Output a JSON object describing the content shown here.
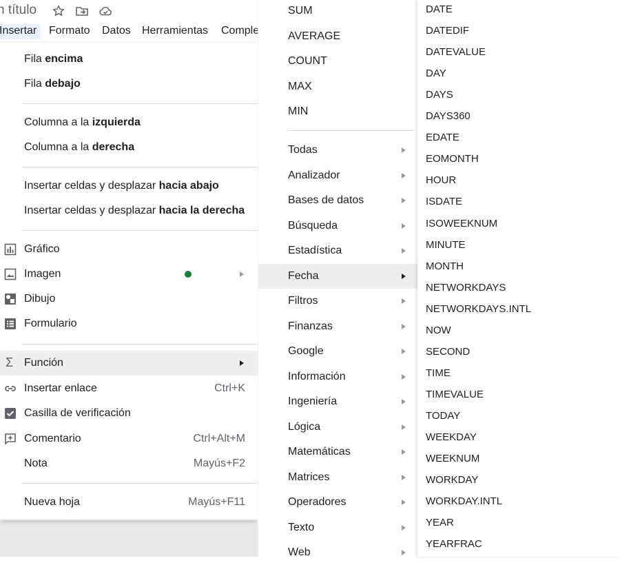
{
  "header": {
    "title": "n título",
    "icons": [
      "star-icon",
      "move-to-folder-icon",
      "cloud-saved-icon"
    ]
  },
  "menubar": [
    "Insertar",
    "Formato",
    "Datos",
    "Herramientas",
    "Comple"
  ],
  "insert_menu": {
    "fila_encima": {
      "pre": "Fila ",
      "bold": "encima"
    },
    "fila_debajo": {
      "pre": "Fila ",
      "bold": "debajo"
    },
    "col_izq": {
      "pre": "Columna a la ",
      "bold": "izquierda"
    },
    "col_der": {
      "pre": "Columna a la ",
      "bold": "derecha"
    },
    "cells_down": {
      "pre": "Insertar celdas y desplazar ",
      "bold": "hacia abajo"
    },
    "cells_right": {
      "pre": "Insertar celdas y desplazar ",
      "bold": "hacia la derecha"
    },
    "grafico": "Gráfico",
    "imagen": "Imagen",
    "dibujo": "Dibujo",
    "formulario": "Formulario",
    "funcion": "Función",
    "enlace": {
      "label": "Insertar enlace",
      "shortcut": "Ctrl+K"
    },
    "casilla": "Casilla de verificación",
    "comentario": {
      "label": "Comentario",
      "shortcut": "Ctrl+Alt+M"
    },
    "nota": {
      "label": "Nota",
      "shortcut": "Mayús+F2"
    },
    "nueva_hoja": {
      "label": "Nueva hoja",
      "shortcut": "Mayús+F11"
    }
  },
  "function_menu": {
    "quick": [
      "SUM",
      "AVERAGE",
      "COUNT",
      "MAX",
      "MIN"
    ],
    "categories": [
      "Todas",
      "Analizador",
      "Bases de datos",
      "Búsqueda",
      "Estadística",
      "Fecha",
      "Filtros",
      "Finanzas",
      "Google",
      "Información",
      "Ingeniería",
      "Lógica",
      "Matemáticas",
      "Matrices",
      "Operadores",
      "Texto",
      "Web"
    ],
    "selected": "Fecha"
  },
  "date_functions": [
    "DATE",
    "DATEDIF",
    "DATEVALUE",
    "DAY",
    "DAYS",
    "DAYS360",
    "EDATE",
    "EOMONTH",
    "HOUR",
    "ISDATE",
    "ISOWEEKNUM",
    "MINUTE",
    "MONTH",
    "NETWORKDAYS",
    "NETWORKDAYS.INTL",
    "NOW",
    "SECOND",
    "TIME",
    "TIMEVALUE",
    "TODAY",
    "WEEKDAY",
    "WEEKNUM",
    "WORKDAY",
    "WORKDAY.INTL",
    "YEAR",
    "YEARFRAC"
  ],
  "colors": {
    "highlight": "#eeeeee",
    "menubar_active": "#e8f0fe",
    "new_dot": "#188038"
  }
}
